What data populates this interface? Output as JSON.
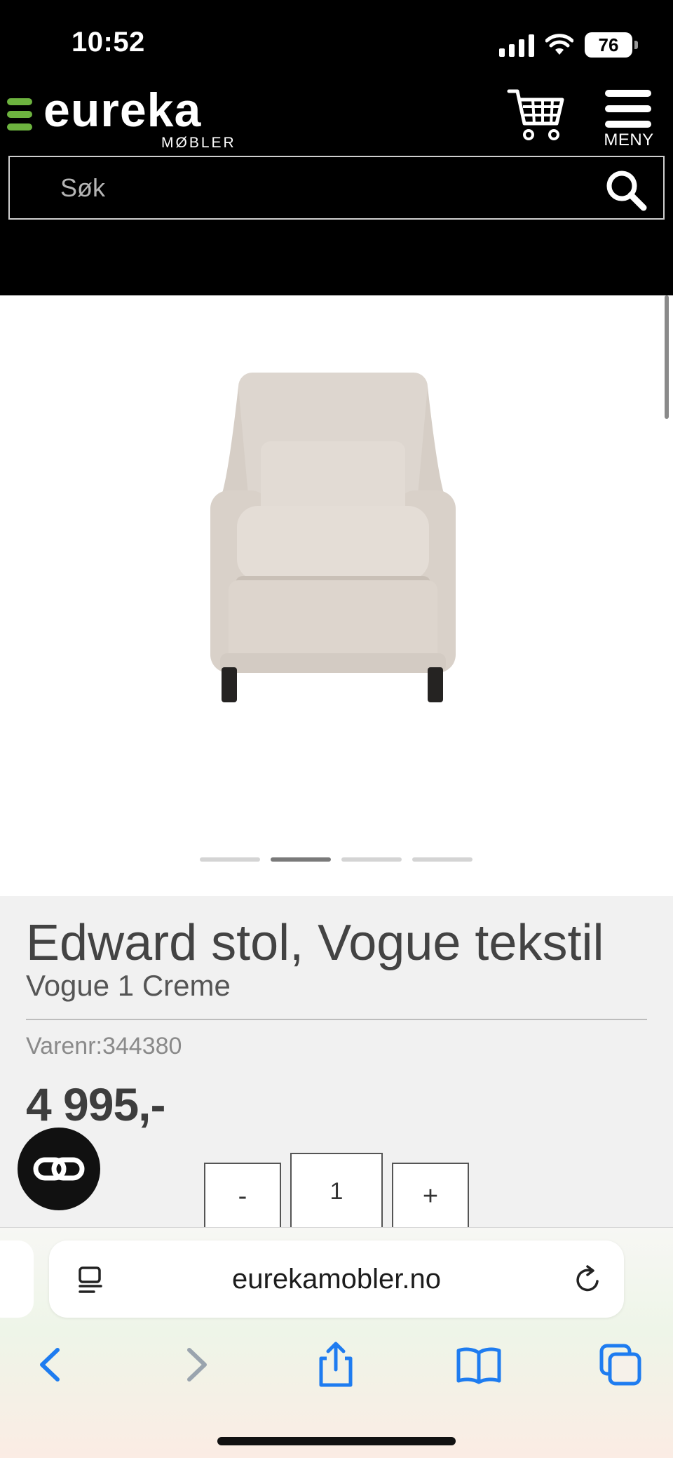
{
  "status_bar": {
    "time": "10:52",
    "battery": "76"
  },
  "header": {
    "logo_text": "eureka",
    "logo_subtext": "MØBLER",
    "menu_label": "MENY",
    "search_placeholder": "Søk"
  },
  "gallery": {
    "slide_count": 4,
    "active_index": 1
  },
  "product": {
    "title": "Edward stol, Vogue tekstil",
    "variant": "Vogue 1 Creme",
    "sku_label": "Varenr:",
    "sku_value": "344380",
    "price": "4 995,-"
  },
  "quantity": {
    "minus_label": "-",
    "value": "1",
    "plus_label": "+"
  },
  "browser": {
    "url": "eurekamobler.no"
  },
  "colors": {
    "brand_green": "#6db33f",
    "header_bg": "#000000",
    "ios_blue": "#1e7cf0"
  }
}
